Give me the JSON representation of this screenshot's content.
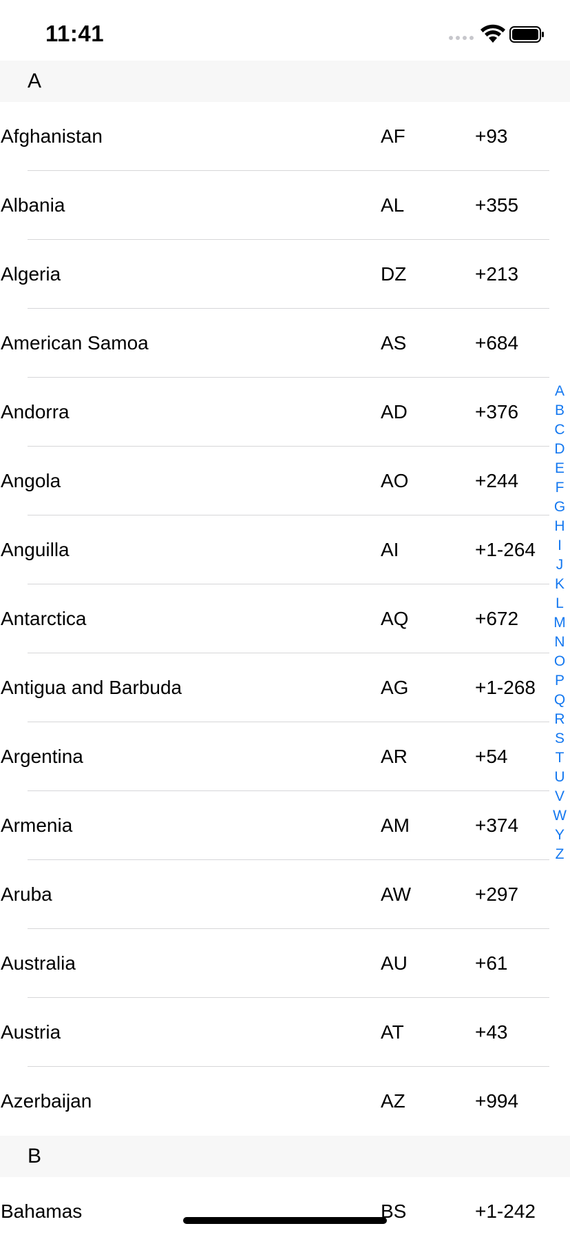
{
  "status_bar": {
    "time": "11:41"
  },
  "sections": [
    {
      "letter": "A",
      "rows": [
        {
          "name": "Afghanistan",
          "code": "AF",
          "dial": "+93"
        },
        {
          "name": "Albania",
          "code": "AL",
          "dial": "+355"
        },
        {
          "name": "Algeria",
          "code": "DZ",
          "dial": "+213"
        },
        {
          "name": "American Samoa",
          "code": "AS",
          "dial": "+684"
        },
        {
          "name": "Andorra",
          "code": "AD",
          "dial": "+376"
        },
        {
          "name": "Angola",
          "code": "AO",
          "dial": "+244"
        },
        {
          "name": "Anguilla",
          "code": "AI",
          "dial": "+1-264"
        },
        {
          "name": "Antarctica",
          "code": "AQ",
          "dial": "+672"
        },
        {
          "name": "Antigua and Barbuda",
          "code": "AG",
          "dial": "+1-268"
        },
        {
          "name": "Argentina",
          "code": "AR",
          "dial": "+54"
        },
        {
          "name": "Armenia",
          "code": "AM",
          "dial": "+374"
        },
        {
          "name": "Aruba",
          "code": "AW",
          "dial": "+297"
        },
        {
          "name": "Australia",
          "code": "AU",
          "dial": "+61"
        },
        {
          "name": "Austria",
          "code": "AT",
          "dial": "+43"
        },
        {
          "name": "Azerbaijan",
          "code": "AZ",
          "dial": "+994"
        }
      ]
    },
    {
      "letter": "B",
      "rows": [
        {
          "name": "Bahamas",
          "code": "BS",
          "dial": "+1-242"
        }
      ]
    }
  ],
  "index_letters": [
    "A",
    "B",
    "C",
    "D",
    "E",
    "F",
    "G",
    "H",
    "I",
    "J",
    "K",
    "L",
    "M",
    "N",
    "O",
    "P",
    "Q",
    "R",
    "S",
    "T",
    "U",
    "V",
    "W",
    "Y",
    "Z"
  ],
  "colors": {
    "accent": "#1478f0",
    "section_background": "#f7f7f7",
    "separator": "#d6d6d8"
  },
  "icons": {
    "wifi": "wifi-icon",
    "battery": "battery-icon",
    "signal": "signal-dots-icon"
  }
}
